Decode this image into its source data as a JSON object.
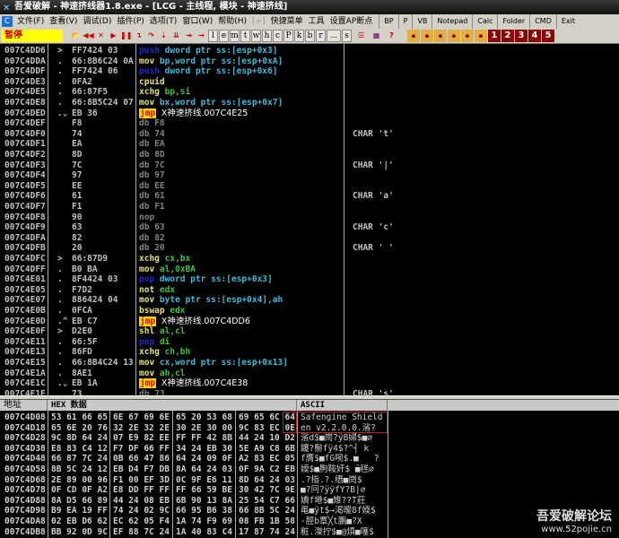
{
  "title": "吾爱破解 - 神速挤线器1.8.exe - [LCG - 主线程, 模块 - 神速挤线]",
  "menu": [
    "文件(F)",
    "查看(V)",
    "调试(D)",
    "插件(P)",
    "选项(T)",
    "窗口(W)",
    "帮助(H)",
    "[+]",
    "快捷菜单",
    "工具",
    "设置AP断点"
  ],
  "menu_tools": [
    "BP",
    "P",
    "VB",
    "Notepad",
    "Calc",
    "Folder",
    "CMD",
    "Exit"
  ],
  "toolbar": {
    "status": "暂停",
    "letters": [
      "l",
      "e",
      "m",
      "t",
      "w",
      "h",
      "c",
      "P",
      "k",
      "b",
      "r",
      "...",
      "s"
    ],
    "numbers": [
      "1",
      "2",
      "3",
      "4",
      "5"
    ]
  },
  "disasm": [
    {
      "addr": "007C4DD6",
      "mark": ">",
      "bytes": "FF7424 03",
      "mn": "push",
      "ops": "dword ptr ss:[esp+0x3]",
      "k": "push"
    },
    {
      "addr": "007C4DDA",
      "mark": ".",
      "bytes": "66:8B6C24 0A",
      "mn": "mov",
      "ops": "bp,word ptr ss:[esp+0xA]",
      "k": "mov"
    },
    {
      "addr": "007C4DDF",
      "mark": ".",
      "bytes": "FF7424 06",
      "mn": "push",
      "ops": "dword ptr ss:[esp+0x6]",
      "k": "push"
    },
    {
      "addr": "007C4DE3",
      "mark": ".",
      "bytes": "0FA2",
      "mn": "cpuid",
      "ops": "",
      "k": "mov"
    },
    {
      "addr": "007C4DE5",
      "mark": ".",
      "bytes": "66:87F5",
      "mn": "xchg",
      "ops": "bp,si",
      "k": "mov"
    },
    {
      "addr": "007C4DE8",
      "mark": ".",
      "bytes": "66:8B5C24 07",
      "mn": "mov",
      "ops": "bx,word ptr ss:[esp+0x7]",
      "k": "mov"
    },
    {
      "addr": "007C4DED",
      "mark": ".⌄",
      "bytes": "EB 36",
      "mn": "jmp",
      "ops": "X神速挤线.007C4E25",
      "k": "jmp"
    },
    {
      "addr": "007C4DEF",
      "mark": "",
      "bytes": "F8",
      "mn": "db",
      "ops": "F8",
      "k": "db"
    },
    {
      "addr": "007C4DF0",
      "mark": "",
      "bytes": "74",
      "mn": "db",
      "ops": "74",
      "k": "db",
      "com": "CHAR 't'"
    },
    {
      "addr": "007C4DF1",
      "mark": "",
      "bytes": "EA",
      "mn": "db",
      "ops": "EA",
      "k": "db"
    },
    {
      "addr": "007C4DF2",
      "mark": "",
      "bytes": "8D",
      "mn": "db",
      "ops": "8D",
      "k": "db"
    },
    {
      "addr": "007C4DF3",
      "mark": "",
      "bytes": "7C",
      "mn": "db",
      "ops": "7C",
      "k": "db",
      "com": "CHAR '|'"
    },
    {
      "addr": "007C4DF4",
      "mark": "",
      "bytes": "97",
      "mn": "db",
      "ops": "97",
      "k": "db"
    },
    {
      "addr": "007C4DF5",
      "mark": "",
      "bytes": "EE",
      "mn": "db",
      "ops": "EE",
      "k": "db"
    },
    {
      "addr": "007C4DF6",
      "mark": "",
      "bytes": "61",
      "mn": "db",
      "ops": "61",
      "k": "db",
      "com": "CHAR 'a'"
    },
    {
      "addr": "007C4DF7",
      "mark": "",
      "bytes": "F1",
      "mn": "db",
      "ops": "F1",
      "k": "db"
    },
    {
      "addr": "007C4DF8",
      "mark": "",
      "bytes": "90",
      "mn": "nop",
      "ops": "",
      "k": "db"
    },
    {
      "addr": "007C4DF9",
      "mark": "",
      "bytes": "63",
      "mn": "db",
      "ops": "63",
      "k": "db",
      "com": "CHAR 'c'"
    },
    {
      "addr": "007C4DFA",
      "mark": "",
      "bytes": "82",
      "mn": "db",
      "ops": "82",
      "k": "db"
    },
    {
      "addr": "007C4DFB",
      "mark": "",
      "bytes": "20",
      "mn": "db",
      "ops": "20",
      "k": "db",
      "com": "CHAR ' '"
    },
    {
      "addr": "007C4DFC",
      "mark": ">",
      "bytes": "66:87D9",
      "mn": "xchg",
      "ops": "cx,bx",
      "k": "mov"
    },
    {
      "addr": "007C4DFF",
      "mark": ".",
      "bytes": "B0 BA",
      "mn": "mov",
      "ops": "al,0xBA",
      "k": "mov"
    },
    {
      "addr": "007C4E01",
      "mark": ".",
      "bytes": "8F4424 03",
      "mn": "pop",
      "ops": "dword ptr ss:[esp+0x3]",
      "k": "push"
    },
    {
      "addr": "007C4E05",
      "mark": ".",
      "bytes": "F7D2",
      "mn": "not",
      "ops": "edx",
      "k": "mov"
    },
    {
      "addr": "007C4E07",
      "mark": ".",
      "bytes": "886424 04",
      "mn": "mov",
      "ops": "byte ptr ss:[esp+0x4],ah",
      "k": "mov"
    },
    {
      "addr": "007C4E0B",
      "mark": ".",
      "bytes": "0FCA",
      "mn": "bswap",
      "ops": "edx",
      "k": "mov"
    },
    {
      "addr": "007C4E0D",
      "mark": ".^",
      "bytes": "EB C7",
      "mn": "jmp",
      "ops": "X神速挤线.007C4DD6",
      "k": "jmp"
    },
    {
      "addr": "007C4E0F",
      "mark": ">",
      "bytes": "D2E0",
      "mn": "shl",
      "ops": "al,cl",
      "k": "mov"
    },
    {
      "addr": "007C4E11",
      "mark": ".",
      "bytes": "66:5F",
      "mn": "pop",
      "ops": "di",
      "k": "push"
    },
    {
      "addr": "007C4E13",
      "mark": ".",
      "bytes": "86FD",
      "mn": "xchg",
      "ops": "ch,bh",
      "k": "mov"
    },
    {
      "addr": "007C4E15",
      "mark": ".",
      "bytes": "66:8B4C24 13",
      "mn": "mov",
      "ops": "cx,word ptr ss:[esp+0x13]",
      "k": "mov"
    },
    {
      "addr": "007C4E1A",
      "mark": ".",
      "bytes": "8AE1",
      "mn": "mov",
      "ops": "ah,cl",
      "k": "mov"
    },
    {
      "addr": "007C4E1C",
      "mark": ".⌄",
      "bytes": "EB 1A",
      "mn": "jmp",
      "ops": "X神速挤线.007C4E38",
      "k": "jmp"
    },
    {
      "addr": "007C4E1E",
      "mark": "",
      "bytes": "73",
      "mn": "db",
      "ops": "73",
      "k": "db",
      "com": "CHAR 's'"
    }
  ],
  "dump": {
    "headers": [
      "地址",
      "HEX 数据",
      "ASCII"
    ],
    "rows": [
      {
        "addr": "007C4D08",
        "hex": [
          "53 61 66 65",
          "6E 67 69 6E",
          "65 20 53 68",
          "69 65 6C 64"
        ],
        "ascii": "Safengine Shield"
      },
      {
        "addr": "007C4D18",
        "hex": [
          "65 6E 20 76",
          "32 2E 32 2E",
          "30 2E 30 00",
          "9C 83 EC 0E"
        ],
        "ascii": "en v2.2.0.0.渻?"
      },
      {
        "addr": "007C4D28",
        "hex": [
          "9C 8D 64 24",
          "07 E9 82 EE",
          "FF FF 42 8B",
          "44 24 10 D2"
        ],
        "ascii": "渻d$■崗?ÿB婦$■∅"
      },
      {
        "addr": "007C4D38",
        "hex": [
          "E8 83 C4 12",
          "F7 DF 66 FF",
          "34 24 EB 30",
          "5E A9 C8 6B"
        ],
        "ascii": "鑳?鬃fÿ4$?^┤ k"
      },
      {
        "addr": "007C4D48",
        "hex": [
          "66 87 7C 24",
          "0B 66 47 86",
          "64 24 09 0F",
          "A2 83 EC 05"
        ],
        "ascii": "f膺$■fG啘$.■   ?"
      },
      {
        "addr": "007C4D58",
        "hex": [
          "8B 5C 24 12",
          "EB D4 F7 DB",
          "8A 64 24 03",
          "0F 9A C2 EB"
        ],
        "ascii": "媆$■朐鞍奸$ ̄■毪∅"
      },
      {
        "addr": "007C4D68",
        "hex": [
          "2E 89 00 96",
          "F1 00 EF 3D",
          "0C 9F E6 11",
          "8D 64 24 03"
        ],
        "ascii": ".?指.?.缙■崗$"
      },
      {
        "addr": "007C4D78",
        "hex": [
          "0F CD 0F A2",
          "E8 DD FF FF",
          "FF 66 59 BE",
          "30 42 7C 9E"
        ],
        "ascii": "■?冋?ÿÿfY?B|∅"
      },
      {
        "addr": "007C4D88",
        "hex": [
          "8A D5 66 89",
          "44 24 08 EB",
          "6B 90 13 8A",
          "25 54 C7 66"
        ],
        "ascii": "婰f塂$■雉??T莊"
      },
      {
        "addr": "007C4D98",
        "hex": [
          "B9 EA 19 FF",
          "74 24 02 9C",
          "66 95 B6 38",
          "66 8B 5C 24"
        ],
        "ascii": "黾■ÿt$→渇暧8f媆$"
      },
      {
        "addr": "007C4DA8",
        "hex": [
          "02 EB D6 62",
          "EC 62 05 F4",
          "1A 74 F9 69",
          "08 FB 1B 58"
        ],
        "ascii": "-脛b覃╳t鵬■?X"
      },
      {
        "addr": "007C4DB8",
        "hex": [
          "BB 92 0D 9C",
          "EF 88 7C 24",
          "1A 40 83 C4",
          "17 87 74 24"
        ],
        "ascii": "粧.滐拧$■@煩■噻$"
      }
    ]
  },
  "watermark": {
    "name": "吾爱破解论坛",
    "url": "www.52pojie.cn"
  },
  "colors": {
    "status_bg": "#ffff00",
    "jmp_bg": "#ffd000",
    "push": "#1c2cc8",
    "mnemonic": "#e8e070",
    "register": "#40c040",
    "memory": "#40b8d8",
    "highlight_box": "#c02020"
  }
}
